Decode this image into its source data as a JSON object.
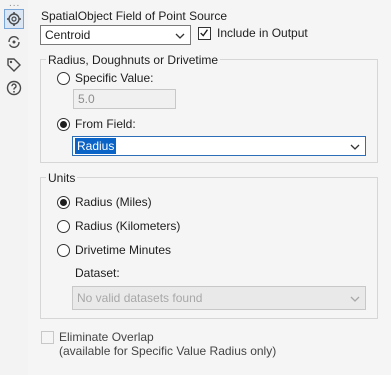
{
  "rail": {
    "dots": "...",
    "icons": [
      "gear-icon",
      "rotate-icon",
      "tag-icon",
      "help-icon"
    ]
  },
  "source": {
    "label": "SpatialObject Field of Point Source",
    "value": "Centroid",
    "include_label": "Include in Output",
    "include_checked": true
  },
  "radius_group": {
    "title": "Radius, Doughnuts or Drivetime",
    "specific_label": "Specific Value:",
    "specific_value": "5.0",
    "from_field_label": "From Field:",
    "from_field_value": "Radius"
  },
  "units": {
    "title": "Units",
    "options": [
      "Radius (Miles)",
      "Radius (Kilometers)",
      "Drivetime Minutes"
    ],
    "selected_index": 0,
    "dataset_label": "Dataset:",
    "dataset_value": "No valid datasets found"
  },
  "eliminate": {
    "label": "Eliminate Overlap",
    "note": "(available for Specific Value Radius only)",
    "checked": false
  }
}
